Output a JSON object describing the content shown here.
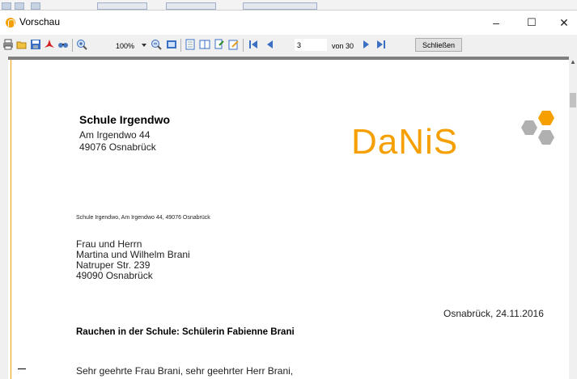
{
  "window": {
    "title": "Vorschau",
    "minimize": "–",
    "maximize": "☐",
    "close": "✕"
  },
  "toolbar": {
    "icons": [
      "print-icon",
      "open-icon",
      "save-icon",
      "pdf-icon",
      "find-icon",
      "zoom-in-icon",
      "zoom-out-icon",
      "fit-page-icon",
      "single-page-icon",
      "two-pages-icon",
      "export-icon",
      "edit-icon",
      "first-page-icon",
      "prev-page-icon",
      "next-page-icon",
      "last-page-icon"
    ],
    "zoom": "100%",
    "page_current": "3",
    "page_of": "von 30",
    "close_label": "Schließen"
  },
  "colors": {
    "accent": "#f5a000",
    "gray": "#b0b0b0"
  },
  "document": {
    "school_name": "Schule Irgendwo",
    "school_street": "Am Irgendwo 44",
    "school_city": "49076 Osnabrück",
    "logo_text": "DaNiS",
    "sender_line": "Schule Irgendwo,  Am Irgendwo 44,  49076 Osnabrück",
    "recipient": [
      "Frau und Herrn",
      "Martina und Wilhelm Brani",
      "Natruper Str. 239",
      "49090 Osnabrück"
    ],
    "date": "Osnabrück, 24.11.2016",
    "subject": "Rauchen in der Schule: Schülerin Fabienne Brani",
    "salutation": "Sehr geehrte Frau Brani, sehr geehrter Herr Brani,"
  }
}
